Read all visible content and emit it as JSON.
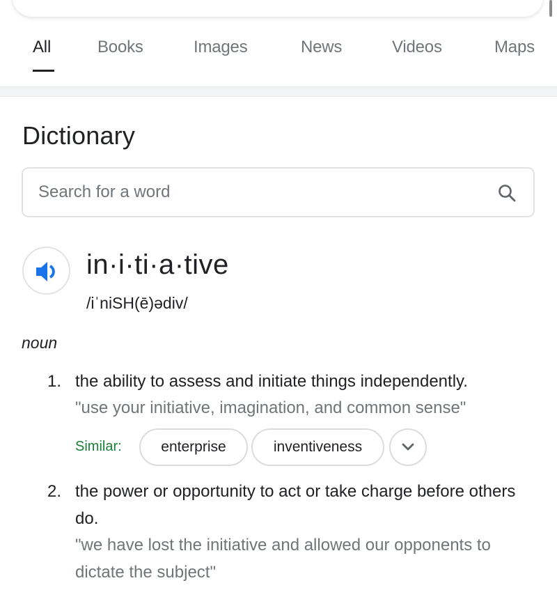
{
  "tabs": [
    {
      "label": "All",
      "active": true
    },
    {
      "label": "Books",
      "active": false
    },
    {
      "label": "Images",
      "active": false
    },
    {
      "label": "News",
      "active": false
    },
    {
      "label": "Videos",
      "active": false
    },
    {
      "label": "Maps",
      "active": false
    }
  ],
  "dictionary": {
    "title": "Dictionary",
    "search": {
      "placeholder": "Search for a word",
      "value": ""
    },
    "entry": {
      "headword": "in·i·ti·a·tive",
      "phonetic": "/iˈniSH(ē)ədiv/",
      "part_of_speech": "noun",
      "senses": [
        {
          "number": "1.",
          "definition": "the ability to assess and initiate things independently.",
          "example": "\"use your initiative, imagination, and common sense\"",
          "similar_label": "Similar:",
          "similar": [
            "enterprise",
            "inventiveness"
          ]
        },
        {
          "number": "2.",
          "definition": "the power or opportunity to act or take charge before others do.",
          "example": "\"we have lost the initiative and allowed our opponents to dictate the subject\""
        }
      ]
    }
  },
  "icons": {
    "speaker": "speaker-icon",
    "search": "search-icon",
    "expand": "chevron-down-icon"
  },
  "colors": {
    "accent_blue": "#1a73e8",
    "similar_green": "#188038",
    "text_primary": "#202124",
    "text_secondary": "#70757a"
  }
}
